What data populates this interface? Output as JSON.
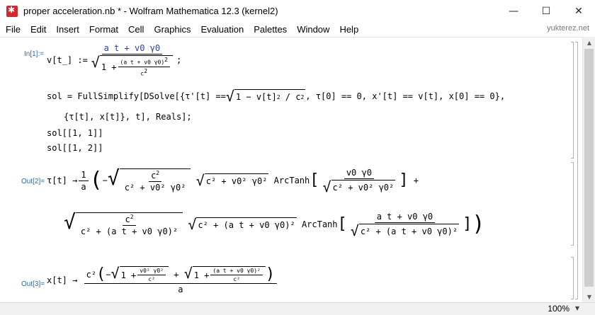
{
  "window": {
    "title": "proper acceleration.nb * - Wolfram Mathematica 12.3 (kernel2)",
    "minimize": "—",
    "maximize": "☐",
    "close": "✕"
  },
  "menu": {
    "items": [
      "File",
      "Edit",
      "Insert",
      "Format",
      "Cell",
      "Graphics",
      "Evaluation",
      "Palettes",
      "Window",
      "Help"
    ],
    "watermark": "yukterez.net"
  },
  "cells": {
    "in1_label": "In[1]:=",
    "out2_label": "Out[2]=",
    "out3_label": "Out[3]="
  },
  "input": {
    "line1_lhs": "v[t_] :=",
    "line1_num": "a t + v0 γ0",
    "line1_rad_prefix": "1 +",
    "line1_inner_num": "(a t + v0 γ0)",
    "line1_inner_den": "c",
    "line1_end": ";",
    "line2": "sol = FullSimplify[DSolve[{τ'[t] == √(1 − v[t]²/c²), τ[0] == 0, x'[t] == v[t], x[0] == 0},",
    "line2_a": "sol = FullSimplify[DSolve[{τ'[t] ==",
    "line2_rad": "1 − v[t]",
    "line2_b": "/ c",
    "line2_c": ", τ[0] == 0, x'[t] == v[t], x[0] == 0},",
    "line3": "{τ[t], x[t]}, t], Reals];",
    "line4": "sol[[1, 1]]",
    "line5": "sol[[1, 2]]"
  },
  "output2": {
    "lhs": "τ[t] →",
    "one": "1",
    "a": "a",
    "minus": "−",
    "c2": "c",
    "den1": "c² + v0² γ0²",
    "rad2": "c² + v0² γ0²",
    "arctanh": "ArcTanh",
    "at_num1": "v0 γ0",
    "at_den1": "c² + v0² γ0²",
    "plus": "+",
    "den2": "c² + (a t + v0 γ0)²",
    "rad3": "c² + (a t + v0 γ0)²",
    "at_num2": "a t + v0 γ0",
    "at_den2": "c² + (a t + v0 γ0)²"
  },
  "output3": {
    "lhs": "x[t] →",
    "c2": "c²",
    "minus": "−",
    "rad1_prefix": "1 +",
    "rad1_num": "v0² γ0²",
    "rad1_den": "c²",
    "plus": "+",
    "rad2_prefix": "1 +",
    "rad2_num": "(a t + v0 γ0)²",
    "rad2_den": "c²",
    "den": "a"
  },
  "status": {
    "zoom": "100%"
  }
}
